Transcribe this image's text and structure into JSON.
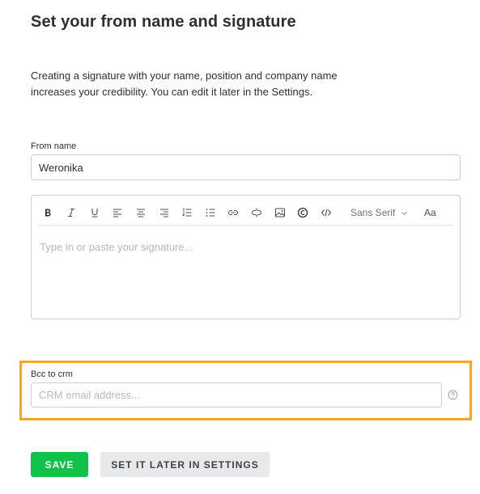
{
  "page": {
    "title": "Set your from name and signature",
    "description_lines": [
      "Creating a signature with your name, position and company name",
      "increases your credibility. You can edit it later in the Settings."
    ]
  },
  "from_name": {
    "label": "From name",
    "value": "Weronika"
  },
  "signature_editor": {
    "toolbar": {
      "buttons": [
        "bold-icon",
        "italic-icon",
        "underline-icon",
        "align-left-icon",
        "align-center-icon",
        "align-right-icon",
        "ordered-list-icon",
        "bullet-list-icon",
        "link-icon",
        "unlink-icon",
        "image-icon",
        "copyright-icon",
        "code-icon"
      ],
      "font": "Sans Serif",
      "size_label": "Aa"
    },
    "placeholder": "Type in or paste your signature..."
  },
  "bcc": {
    "label": "Bcc to crm",
    "placeholder": "CRM email address...",
    "highlight_color": "#f5a623"
  },
  "actions": {
    "save_label": "SAVE",
    "later_label": "SET IT LATER IN SETTINGS",
    "save_color": "#12c14a"
  }
}
